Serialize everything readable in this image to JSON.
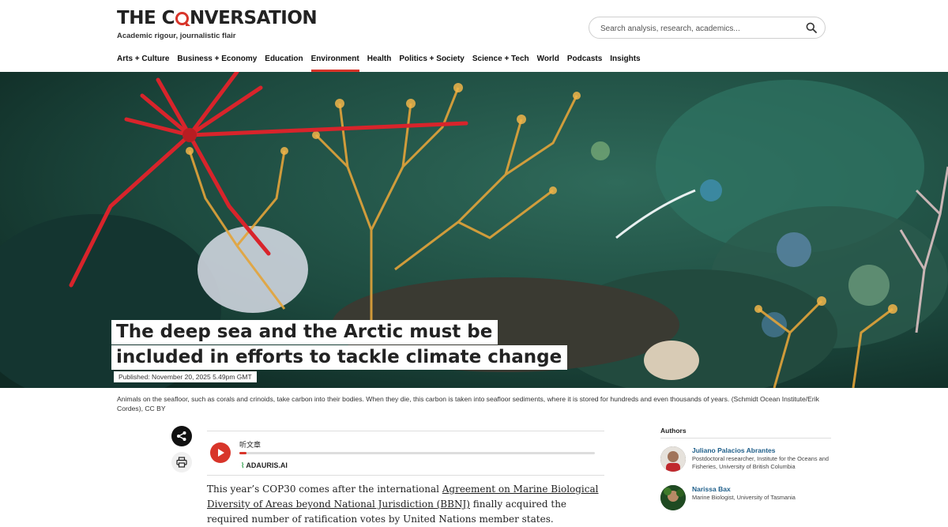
{
  "site": {
    "logo_pre": "THE C",
    "logo_post": "NVERSATION",
    "tagline": "Academic rigour, journalistic flair"
  },
  "search": {
    "placeholder": "Search analysis, research, academics..."
  },
  "nav": {
    "items": [
      {
        "label": "Arts + Culture"
      },
      {
        "label": "Business + Economy"
      },
      {
        "label": "Education"
      },
      {
        "label": "Environment"
      },
      {
        "label": "Health"
      },
      {
        "label": "Politics + Society"
      },
      {
        "label": "Science + Tech"
      },
      {
        "label": "World"
      },
      {
        "label": "Podcasts"
      },
      {
        "label": "Insights"
      }
    ],
    "active": "Environment",
    "accent_color": "#d8352a"
  },
  "article": {
    "headline_line1": "The deep sea and the Arctic must be",
    "headline_line2": "included in efforts to tackle climate change",
    "published": "Published: November 20, 2025 5.49pm GMT",
    "caption": "Animals on the seafloor, such as corals and crinoids, take carbon into their bodies. When they die, this carbon is taken into seafloor sediments, where it is stored for hundreds and even thousands of years. (Schmidt Ocean Institute/Erik Cordes), CC BY",
    "body_before_link": "This year’s COP30 comes after the international ",
    "body_link": "Agreement on Marine Biological Diversity of Areas beyond National Jurisdiction (BBNJ)",
    "body_after_link": " finally acquired the required number of ratification votes by United Nations member states."
  },
  "player": {
    "title": "听文章",
    "brand": "ADAURIS.AI",
    "progress": 0.02
  },
  "authors": {
    "heading": "Authors",
    "list": [
      {
        "name": "Juliano Palacios Abrantes",
        "role": "Postdoctoral researcher, Institute for the Oceans and Fisheries, University of British Columbia"
      },
      {
        "name": "Narissa Bax",
        "role": "Marine Biologist, University of Tasmania"
      }
    ]
  }
}
